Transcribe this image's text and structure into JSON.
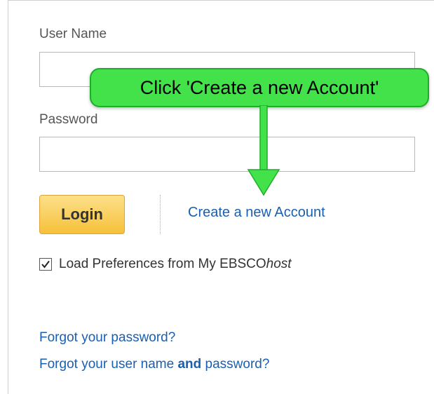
{
  "form": {
    "username_label": "User Name",
    "username_value": "",
    "password_label": "Password",
    "password_value": "",
    "login_label": "Login",
    "create_account_label": "Create a new Account",
    "load_prefs_label_prefix": "Load Preferences from My EBSCO",
    "load_prefs_label_suffix": "host",
    "load_prefs_checked": true,
    "forgot_password_label": "Forgot your password?",
    "forgot_both_prefix": "Forgot your user name ",
    "forgot_both_bold": "and",
    "forgot_both_suffix": " password?"
  },
  "annotation": {
    "callout_text": "Click 'Create a new Account'",
    "callout_color": "#43e14a"
  },
  "colors": {
    "link": "#1a5fb0",
    "login_button": "#f6c13a"
  }
}
